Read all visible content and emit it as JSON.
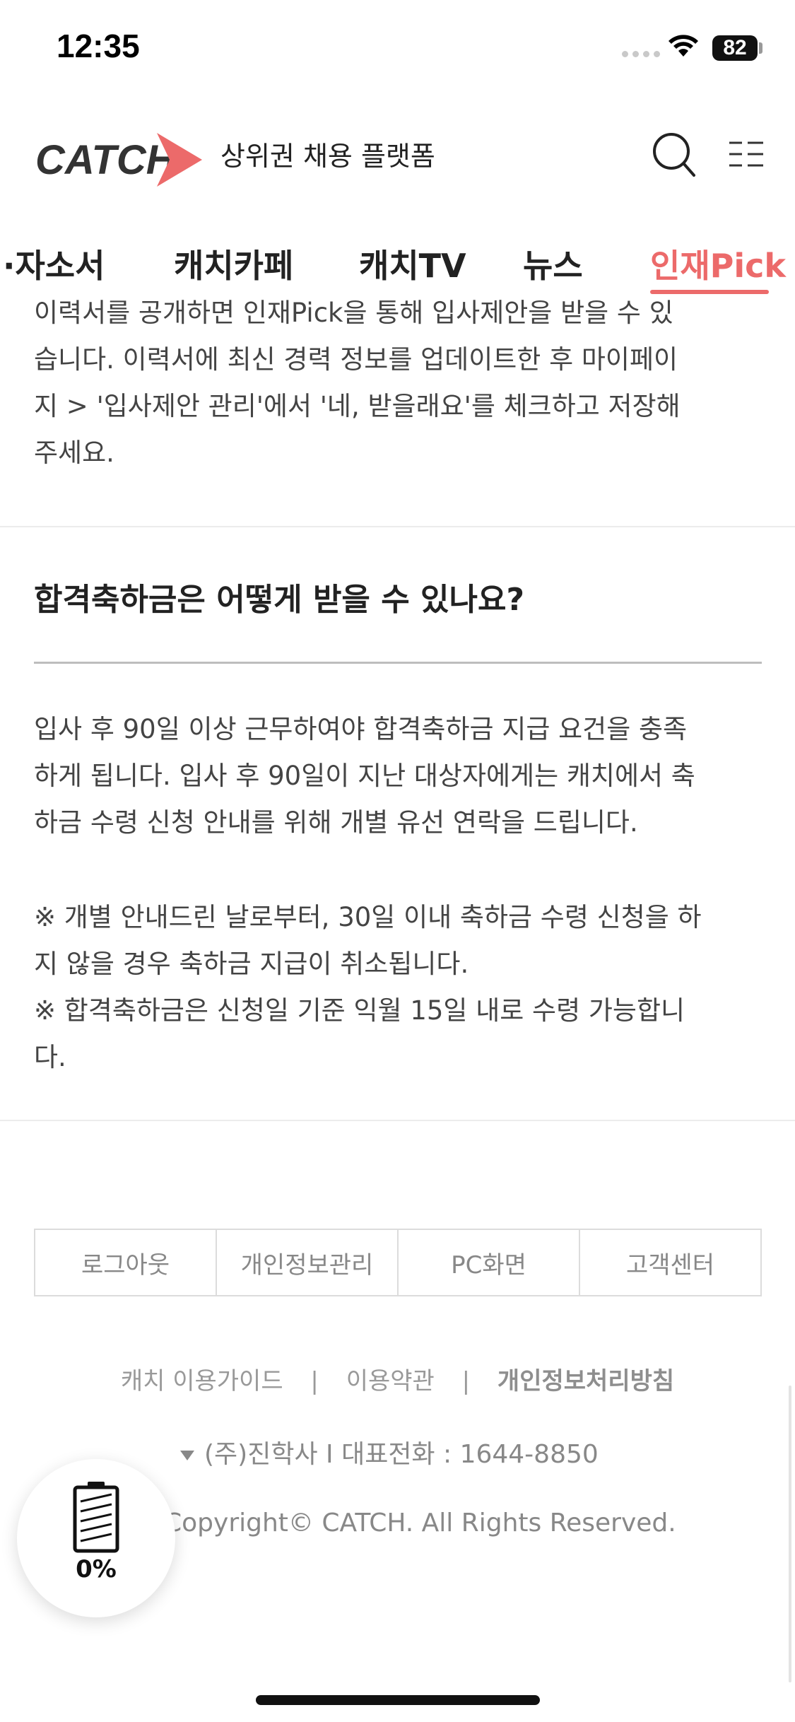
{
  "status_bar": {
    "time": "12:35",
    "battery": "82"
  },
  "header": {
    "subtitle": "상위권 채용 플랫폼",
    "logo_text": "CATCH",
    "accent_color": "#ec6a6a"
  },
  "nav": {
    "tabs": [
      {
        "label": "·자소서",
        "active": false
      },
      {
        "label": "캐치카페",
        "active": false
      },
      {
        "label": "캐치TV",
        "active": false
      },
      {
        "label": "뉴스",
        "active": false
      },
      {
        "label": "인재Pick",
        "active": true
      }
    ]
  },
  "content": {
    "prev_answer_lines": [
      "이력서를 공개하면 인재Pick을 통해 입사제안을 받을 수 있",
      "습니다. 이력서에 최신 경력 정보를 업데이트한 후 마이페이",
      "지 > '입사제안 관리'에서 '네, 받을래요'를 체크하고 저장해",
      "주세요."
    ],
    "question": "합격축하금은 어떻게 받을 수 있나요?",
    "answer_lines": [
      "입사 후 90일 이상 근무하여야 합격축하금 지급 요건을 충족",
      "하게 됩니다. 입사 후 90일이 지난 대상자에게는 캐치에서 축",
      "하금 수령 신청 안내를 위해 개별 유선 연락을 드립니다."
    ],
    "notes": [
      "※ 개별 안내드린 날로부터, 30일 이내 축하금 수령 신청을 하",
      "지 않을 경우 축하금 지급이 취소됩니다.",
      "※ 합격축하금은 신청일 기준 익월 15일 내로 수령 가능합니",
      "다."
    ]
  },
  "footer": {
    "buttons": [
      "로그아웃",
      "개인정보관리",
      "PC화면",
      "고객센터"
    ],
    "links": [
      "캐치 이용가이드",
      "이용약관",
      "개인정보처리방침"
    ],
    "separator": "|",
    "company": "(주)진학사 I 대표전화 : 1644-8850",
    "copyright": "Copyright© CATCH. All Rights Reserved."
  },
  "widget": {
    "percent": "0%",
    "icon": "battery-icon"
  }
}
